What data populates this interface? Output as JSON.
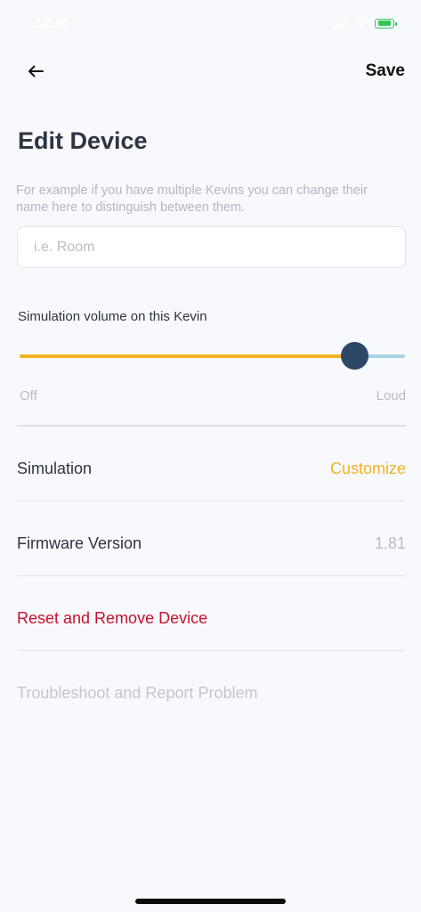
{
  "status_bar": {
    "time": "12:00"
  },
  "nav": {
    "back_icon": "arrow-left-icon",
    "save_label": "Save"
  },
  "page": {
    "title": "Edit Device",
    "helper_text": "For example if you have multiple Kevins you can change their name here to distinguish between them."
  },
  "name_field": {
    "value": "",
    "placeholder": "i.e. Room"
  },
  "volume": {
    "label": "Simulation volume on this Kevin",
    "min_label": "Off",
    "max_label": "Loud",
    "level": 0.87,
    "fill_color": "#f4b223",
    "rest_color": "#a8d4e2",
    "thumb_color": "#2d4766"
  },
  "settings": {
    "simulation": {
      "label": "Simulation",
      "action": "Customize"
    },
    "firmware": {
      "label": "Firmware Version",
      "value": "1.81"
    },
    "reset": {
      "label": "Reset and Remove Device",
      "color": "#c8102e"
    },
    "troubleshoot": {
      "label": "Troubleshoot and Report Problem"
    }
  },
  "colors": {
    "accent": "#f4b223",
    "background": "#f8f9fc",
    "text": "#2f3441"
  }
}
